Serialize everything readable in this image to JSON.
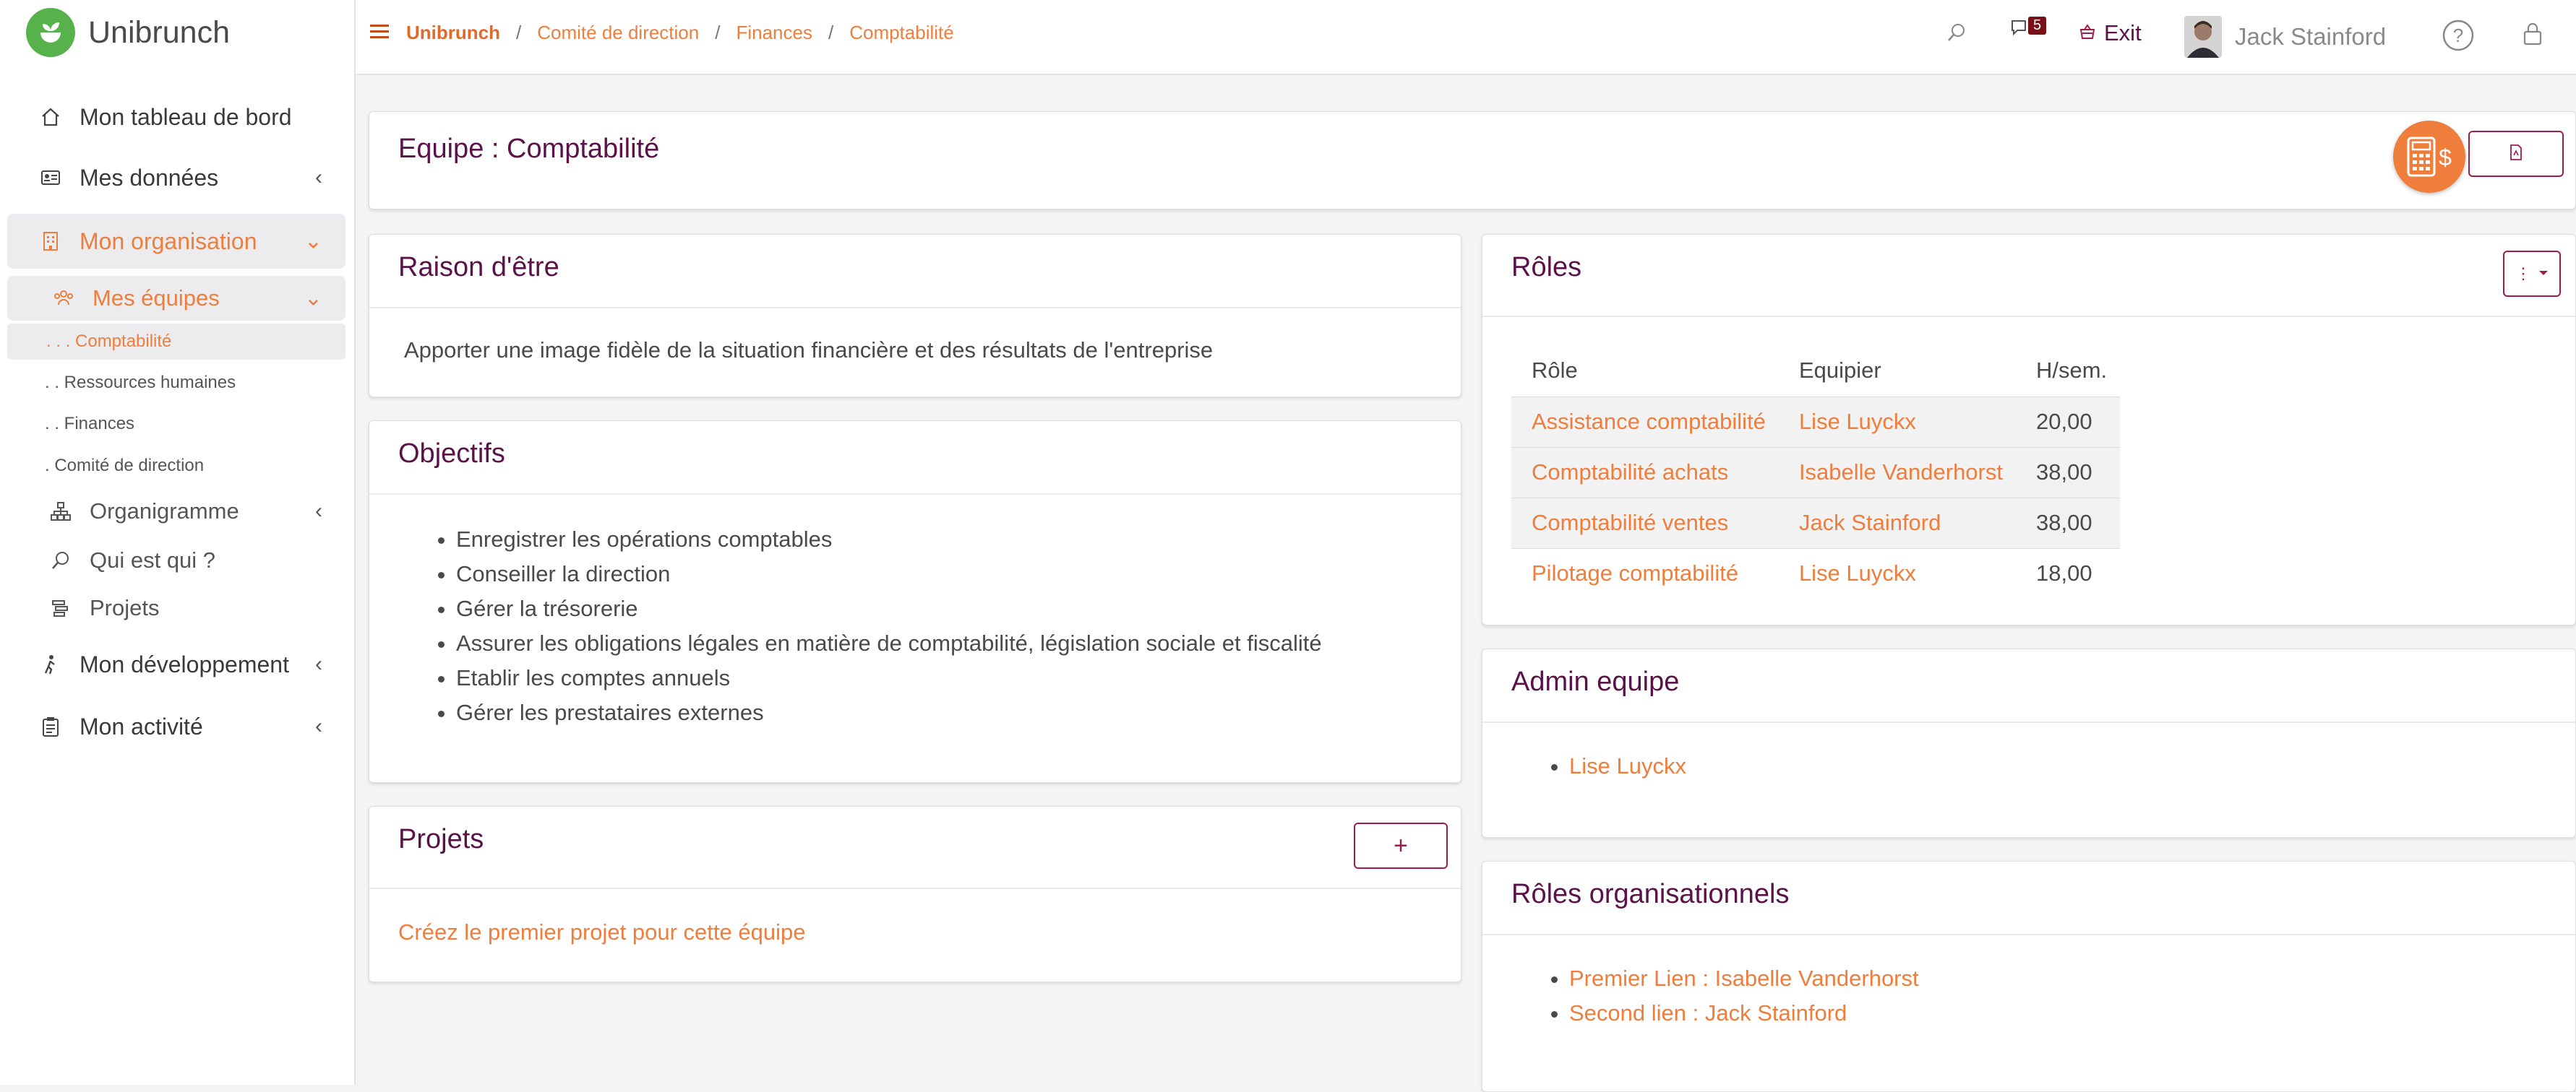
{
  "app": {
    "name": "Unibrunch"
  },
  "sidebar": {
    "dashboard": "Mon tableau de bord",
    "my_data": "Mes données",
    "my_org": "Mon organisation",
    "my_teams": "Mes équipes",
    "teams": [
      ". . . Comptabilité",
      ". . Ressources humaines",
      ". . Finances",
      ". Comité de direction"
    ],
    "orgchart": "Organigramme",
    "who": "Qui est qui ?",
    "projects": "Projets",
    "my_dev": "Mon développement",
    "my_activity": "Mon activité"
  },
  "breadcrumb": [
    "Unibrunch",
    "Comité de direction",
    "Finances",
    "Comptabilité"
  ],
  "topbar": {
    "notif_count": "5",
    "exit": "Exit",
    "user": "Jack Stainford"
  },
  "header": {
    "title": "Equipe : Comptabilité"
  },
  "raison": {
    "title": "Raison d'être",
    "text": "Apporter une image fidèle de la situation financière et des résultats de l'entreprise"
  },
  "objectifs": {
    "title": "Objectifs",
    "items": [
      "Enregistrer les opérations comptables",
      "Conseiller la direction",
      "Gérer la trésorerie",
      "Assurer les obligations légales en matière de comptabilité, législation sociale et fiscalité",
      "Etablir les comptes annuels",
      "Gérer les prestataires externes"
    ]
  },
  "projets": {
    "title": "Projets",
    "empty_link": "Créez le premier projet pour cette équipe",
    "add": "+"
  },
  "roles": {
    "title": "Rôles",
    "headers": [
      "Rôle",
      "Equipier",
      "H/sem."
    ],
    "rows": [
      {
        "role": "Assistance comptabilité",
        "member": "Lise Luyckx",
        "hours": "20,00"
      },
      {
        "role": "Comptabilité achats",
        "member": "Isabelle Vanderhorst",
        "hours": "38,00"
      },
      {
        "role": "Comptabilité ventes",
        "member": "Jack Stainford",
        "hours": "38,00"
      },
      {
        "role": "Pilotage comptabilité",
        "member": "Lise Luyckx",
        "hours": "18,00"
      }
    ]
  },
  "admin": {
    "title": "Admin equipe",
    "items": [
      "Lise Luyckx"
    ]
  },
  "org_roles": {
    "title": "Rôles organisationnels",
    "items": [
      "Premier Lien : Isabelle Vanderhorst",
      "Second lien : Jack Stainford"
    ]
  },
  "colors": {
    "accent": "#ef7d3c",
    "title": "#5a1248",
    "button": "#a01b4b",
    "logo": "#58b24b"
  }
}
